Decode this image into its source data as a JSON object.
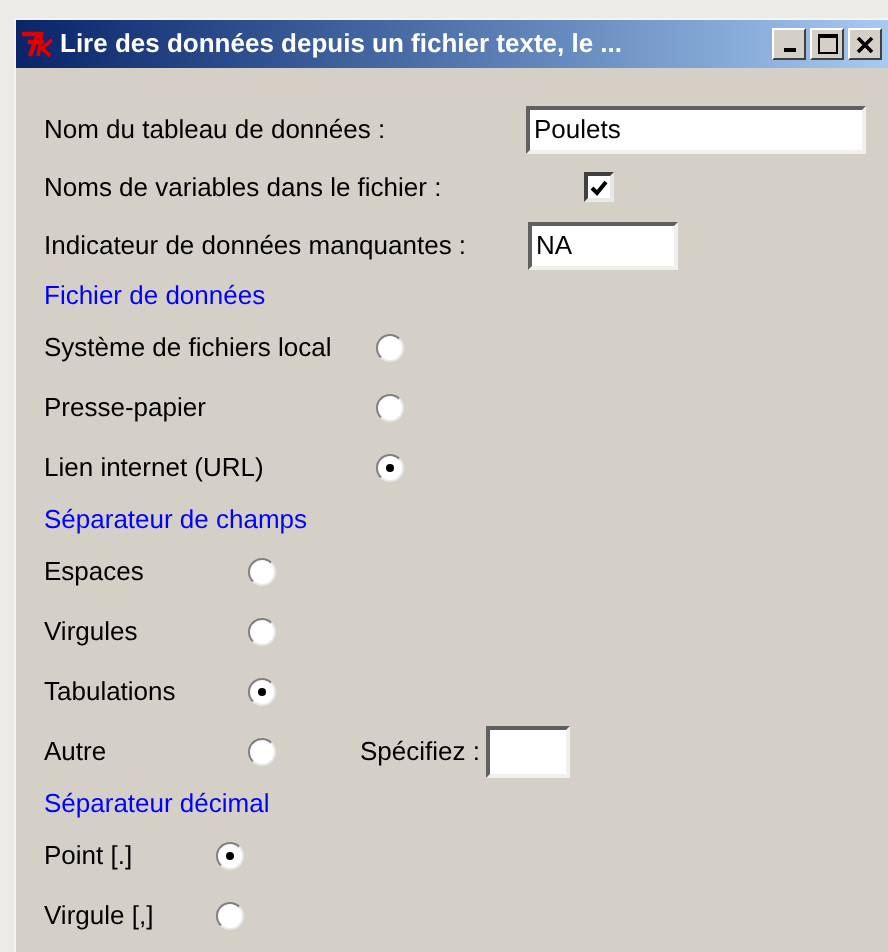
{
  "window": {
    "title": "Lire des données depuis un fichier texte, le ..."
  },
  "fields": [
    {
      "kind": "text",
      "label": "Nom du tableau de données :",
      "value": "Poulets"
    },
    {
      "kind": "checkbox",
      "label": "Noms de variables dans le fichier :",
      "checked": true
    },
    {
      "kind": "short",
      "label": "Indicateur de données manquantes :",
      "value": "NA"
    }
  ],
  "groups": [
    {
      "title": "Fichier de données",
      "options": [
        {
          "label": "Système de fichiers local",
          "selected": false
        },
        {
          "label": "Presse-papier",
          "selected": false
        },
        {
          "label": "Lien internet (URL)",
          "selected": true
        }
      ]
    },
    {
      "title": "Séparateur de champs",
      "options": [
        {
          "label": "Espaces",
          "selected": false
        },
        {
          "label": "Virgules",
          "selected": false
        },
        {
          "label": "Tabulations",
          "selected": true
        },
        {
          "label": "Autre",
          "selected": false,
          "specify_label": "Spécifiez :"
        }
      ]
    },
    {
      "title": "Séparateur décimal",
      "options": [
        {
          "label": "Point [.]",
          "selected": true
        },
        {
          "label": "Virgule [,]",
          "selected": false
        }
      ]
    }
  ]
}
